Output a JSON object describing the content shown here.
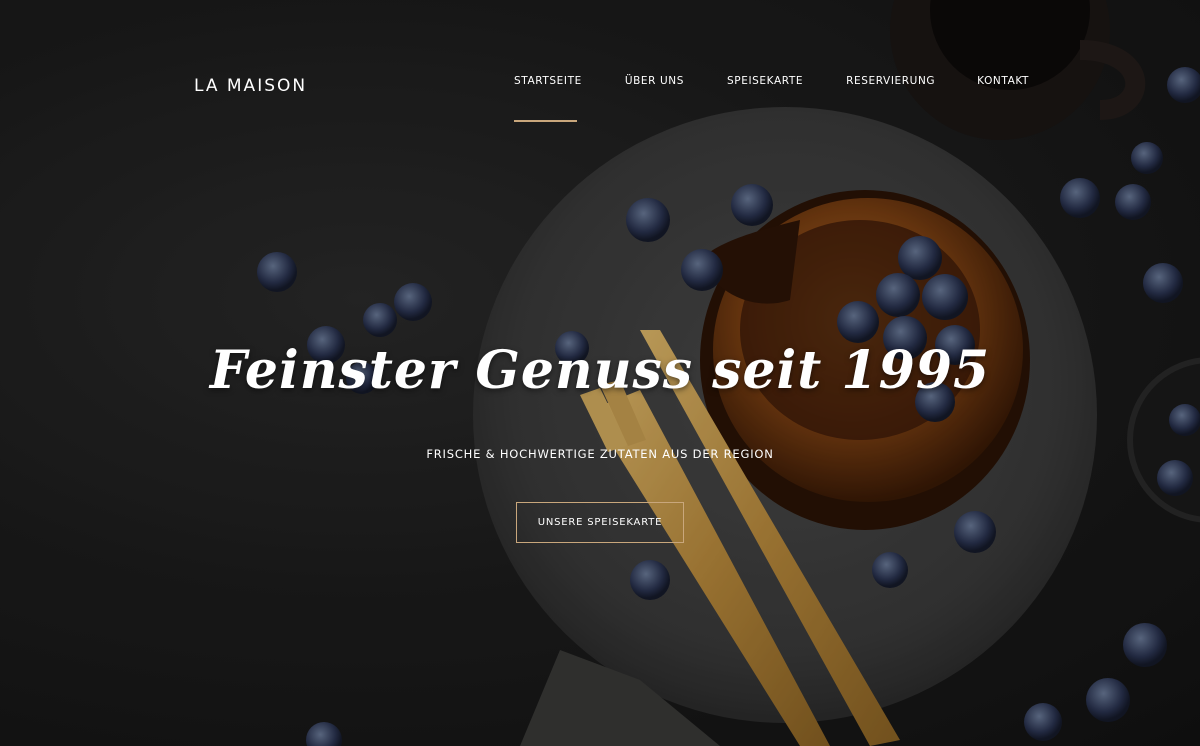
{
  "brand": {
    "logo": "LA MAISON"
  },
  "nav": {
    "items": [
      {
        "label": "STARTSEITE",
        "active": true
      },
      {
        "label": "ÜBER UNS",
        "active": false
      },
      {
        "label": "SPEISEKARTE",
        "active": false
      },
      {
        "label": "RESERVIERUNG",
        "active": false
      },
      {
        "label": "KONTAKT",
        "active": false
      }
    ]
  },
  "hero": {
    "headline": "Feinster Genuss seit 1995",
    "subline": "FRISCHE & HOCHWERTIGE ZUTATEN AUS DER REGION",
    "cta_label": "UNSERE SPEISEKARTE"
  },
  "colors": {
    "accent": "#c9a77c",
    "background": "#151515",
    "text": "#ffffff"
  }
}
